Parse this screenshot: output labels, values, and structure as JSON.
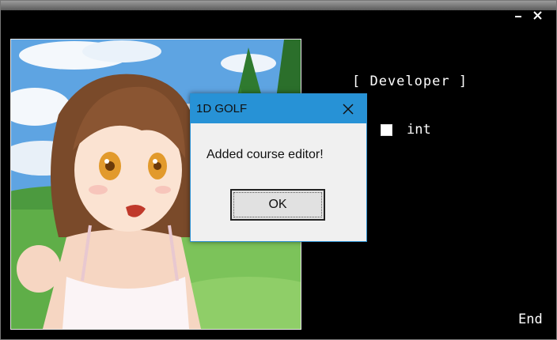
{
  "window": {
    "controls": {
      "minimize_icon": "minimize-icon",
      "close_icon": "close-icon"
    }
  },
  "developer": {
    "header": "[ Developer ]",
    "options": [
      {
        "label": "int",
        "checked": true
      }
    ]
  },
  "end_label": "End",
  "dialog": {
    "title": "1D GOLF",
    "message": "Added course editor!",
    "ok_label": "OK",
    "accent_color": "#2792d6"
  },
  "artwork": {
    "subject": "anime-girl-illustration"
  }
}
